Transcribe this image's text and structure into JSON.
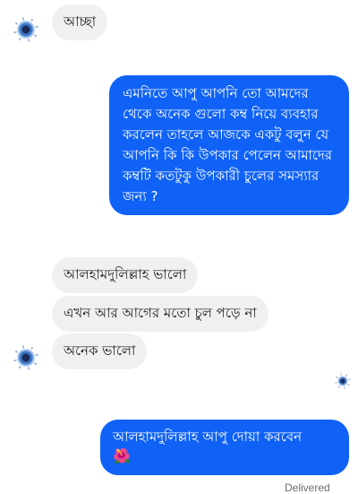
{
  "messages": [
    {
      "id": "m1",
      "direction": "incoming",
      "text": "আচ্ছা"
    },
    {
      "id": "m2",
      "direction": "outgoing",
      "text": "এমনিতে আপু আপনি তো আমদের থেকে অনেক গুলো কম্ব নিয়ে ব্যবহার করলেন তাহলে আজকে একটু বলুন যে আপনি কি কি উপকার পেলেন আমাদের কম্বটি কতটুকু উপকারী চুলের সমস্যার জন্য ?"
    },
    {
      "id": "m3",
      "direction": "incoming",
      "text": "আলহামদুলিল্লাহ ভালো"
    },
    {
      "id": "m4",
      "direction": "incoming",
      "text": "এখন আর আগের মতো চুল পড়ে না"
    },
    {
      "id": "m5",
      "direction": "incoming",
      "text": "অনেক ভালো"
    },
    {
      "id": "m6",
      "direction": "outgoing",
      "text": "আলহামদুলিল্লাহ আপু দোয়া করবেন",
      "emoji": "🌺"
    }
  ],
  "status": "Delivered",
  "icons": {
    "contact_avatar": "contact-avatar-icon",
    "seen_indicator": "seen-avatar-icon",
    "emoji": "hibiscus-flower"
  },
  "colors": {
    "outgoing_bubble": "#0f62f5",
    "incoming_bubble": "#f0f0f0"
  }
}
